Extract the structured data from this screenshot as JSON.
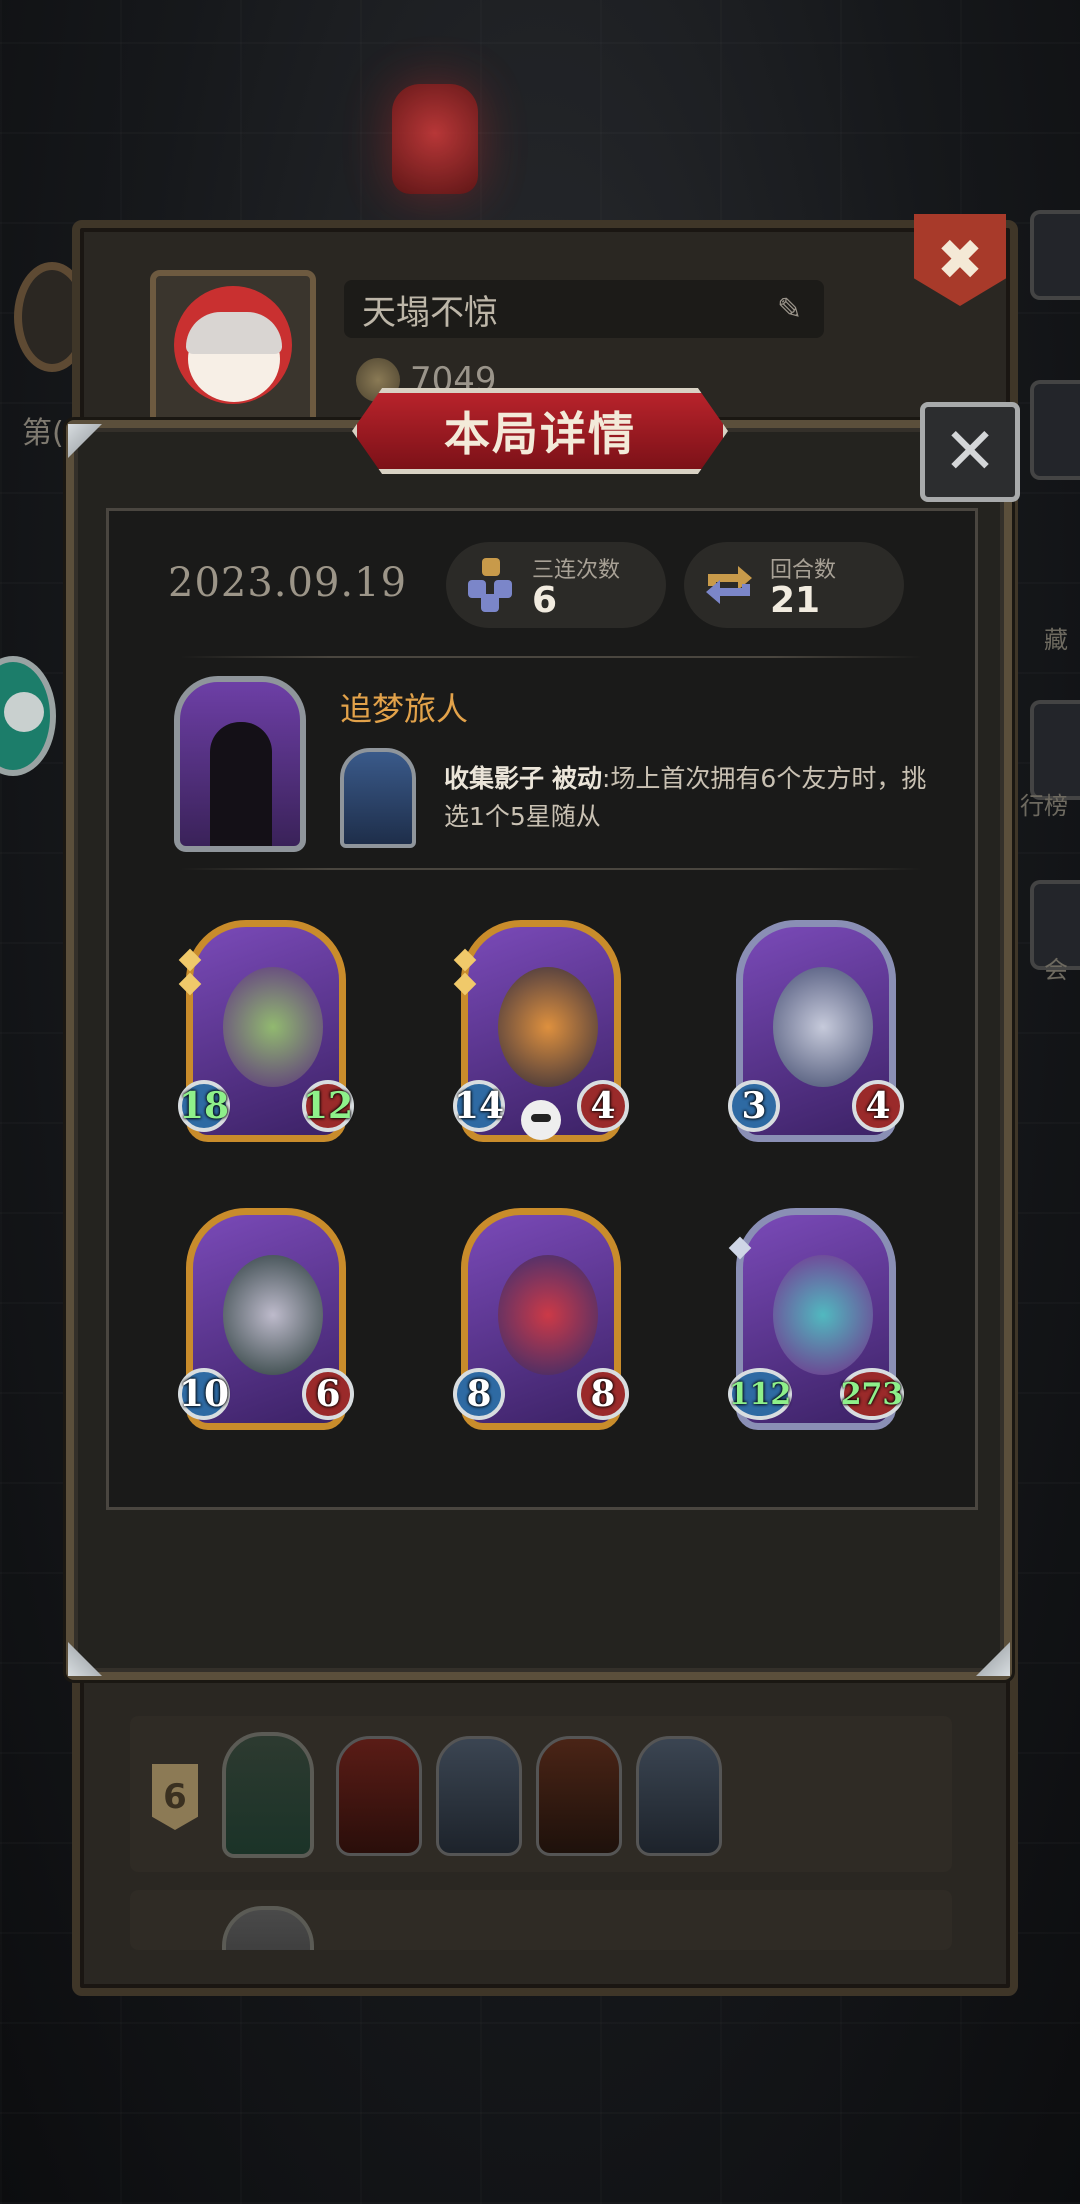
{
  "background": {
    "left_label": "第(",
    "right_labels": [
      "藏",
      "行榜",
      "会"
    ]
  },
  "profile": {
    "player_name": "天塌不惊",
    "coins": "7049"
  },
  "dialog": {
    "title": "本局详情",
    "date": "2023.09.19",
    "stats": [
      {
        "label": "三连次数",
        "value": "6",
        "icon": "triple-icon"
      },
      {
        "label": "回合数",
        "value": "21",
        "icon": "round-cycle-icon"
      }
    ],
    "hero": {
      "name": "追梦旅人",
      "skill_name": "收集影子",
      "skill_type": "被动",
      "skill_desc": ":场上首次拥有6个友方时，挑选1个5星随从"
    },
    "cards": [
      {
        "attack": "18",
        "health": "12",
        "frame": "gold",
        "buffed": true,
        "creature": "purple-dragon"
      },
      {
        "attack": "14",
        "health": "4",
        "frame": "gold",
        "buffed": false,
        "creature": "flame-bear"
      },
      {
        "attack": "3",
        "health": "4",
        "frame": "silver",
        "buffed": false,
        "creature": "horned-beast"
      },
      {
        "attack": "10",
        "health": "6",
        "frame": "gold",
        "buffed": false,
        "creature": "skull-mage"
      },
      {
        "attack": "8",
        "health": "8",
        "frame": "gold",
        "buffed": false,
        "creature": "clown"
      },
      {
        "attack": "112",
        "health": "273",
        "frame": "silver",
        "buffed": true,
        "creature": "crowned-serpent"
      }
    ]
  },
  "history": {
    "rows": [
      {
        "rank": "6"
      }
    ]
  },
  "colors": {
    "accent_red": "#b8232b",
    "hero_name": "#e2a24a",
    "buff_green": "#8ef08a",
    "gold_frame": "#c98c2b",
    "silver_frame": "#8a8fb5"
  }
}
